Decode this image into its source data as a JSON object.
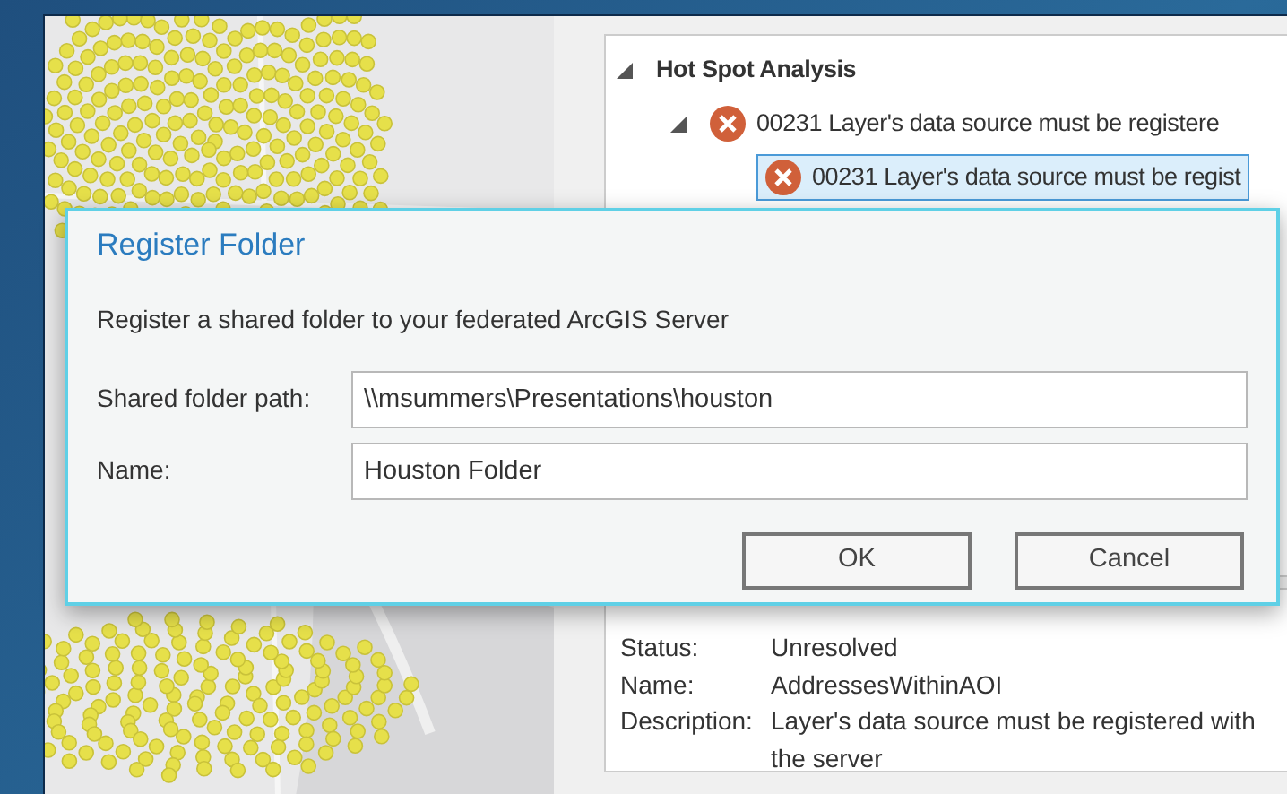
{
  "tree": {
    "label": "Hot Spot Analysis",
    "expanded": true,
    "children": [
      {
        "label": "00231 Layer's data source must be registere",
        "expanded": true,
        "kind": "error",
        "selected": false,
        "children": [
          {
            "label": "00231 Layer's data source must be regist",
            "kind": "error",
            "selected": true
          }
        ]
      }
    ]
  },
  "details": [
    {
      "label": "Status:",
      "value": "Unresolved"
    },
    {
      "label": "Name:",
      "value": "AddressesWithinAOI"
    },
    {
      "label": "Description:",
      "value": "Layer's data source must be registered with the server"
    }
  ],
  "dialog": {
    "title": "Register Folder",
    "message": "Register a shared folder to your federated ArcGIS Server",
    "fields": [
      {
        "label": "Shared folder path:",
        "value": "\\\\msummers\\Presentations\\houston"
      },
      {
        "label": "Name:",
        "value": "Houston Folder"
      }
    ],
    "buttons": [
      "OK",
      "Cancel"
    ]
  }
}
